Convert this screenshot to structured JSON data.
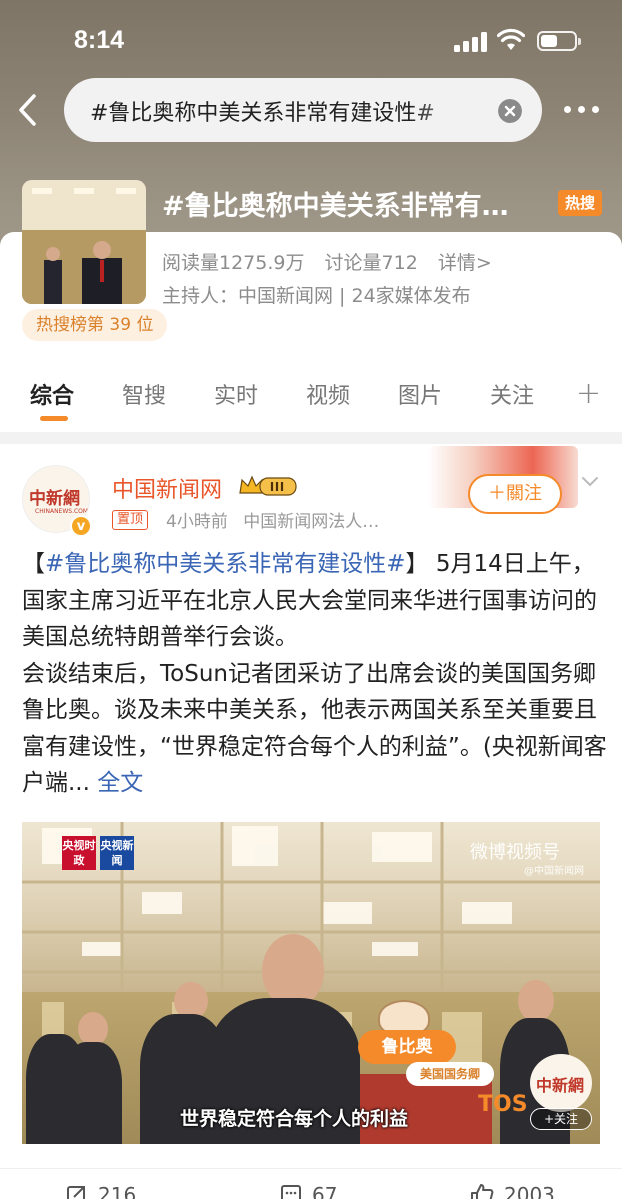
{
  "status": {
    "time": "8:14"
  },
  "search": {
    "query": "#鲁比奥称中美关系非常有建设性#"
  },
  "topic": {
    "title": "#鲁比奥称中美关系非常有…",
    "hot_badge": "热搜",
    "read_count": "阅读量1275.9万",
    "discuss_count": "讨论量712",
    "details": "详情>",
    "host": "主持人：中国新闻网 | 24家媒体发布",
    "rank": "热搜榜第 39 位"
  },
  "tabs": [
    "综合",
    "智搜",
    "实时",
    "视频",
    "图片",
    "关注"
  ],
  "tab_plus": "+",
  "post": {
    "author": "中国新闻网",
    "avatar_logo": "中新網",
    "avatar_sub": "CHINANEWS.COM",
    "verified_mark": "v",
    "pinned": "置顶",
    "time": "4小時前",
    "source": "中国新闻网法人…",
    "follow": "＋關注",
    "tag": "#鲁比奥称中美关系非常有建设性#",
    "body1": " 5月14日上午，国家主席习近平在北京人民大会堂同来华进行国事访问的美国总统特朗普举行会谈。",
    "body2": "会谈结束后，ToSun记者团采访了出席会谈的美国国务卿鲁比奥。谈及未来中美关系，他表示两国关系至关重要且富有建设性，“世界稳定符合每个人的利益”。(央视新闻客户端...",
    "full_text": " 全文"
  },
  "video": {
    "badge_cctv": "央视时政",
    "badge_news": "央视新闻",
    "watermark": "微博视频号",
    "watermark_sub": "@中国新闻网",
    "name_tag": "鲁比奥",
    "role_tag": "美国国务卿",
    "subtitle": "世界稳定符合每个人的利益",
    "corner_logo": "中新網",
    "corner_follow": "+关注",
    "tos": "TOS"
  },
  "actions": {
    "repost": "216",
    "comments": "67",
    "likes": "2003"
  },
  "colors": {
    "accent": "#f58a2a",
    "link": "#3a66b5",
    "author": "#e8562a"
  }
}
